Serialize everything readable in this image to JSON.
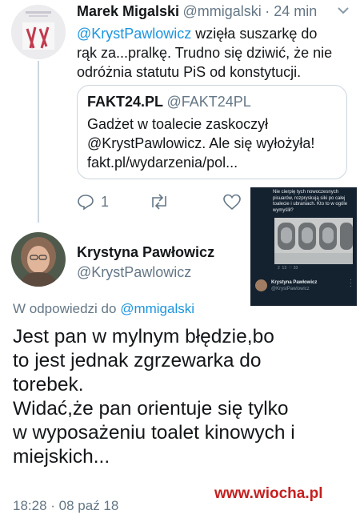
{
  "tweet1": {
    "author_name": "Marek Migalski",
    "author_handle": "@mmigalski",
    "time": "· 24 min",
    "text_mention": "@KrystPawlowicz",
    "text_line1_rest": " wzięła suszarkę do",
    "text_line2": "rąk za...pralkę. Trudno się dziwić, że nie",
    "text_line3": "odróżnia statutu PiS od konstytucji.",
    "quote": {
      "name": "FAKT24.PL",
      "handle": "@FAKT24PL",
      "line1": "Gadżet w toalecie zaskoczył",
      "line2": "@KrystPawlowicz. Ale się wyłożyła!",
      "line3": "fakt.pl/wydarzenia/pol..."
    },
    "reply_count": "1",
    "icons": [
      "reply-icon",
      "retweet-icon",
      "like-icon",
      "chevron-down-icon"
    ]
  },
  "thumbnail": {
    "caption_line1": "Nie cierpię tych nowoczesnych",
    "caption_line2": "pisuarów, rozpryskują siki po całej",
    "caption_line3": "toalecie i ubraniach. Kto to w ogóle",
    "caption_line4": "wymyślił?",
    "stats": "2  13  ♡ 33",
    "author_name": "Krystyna Pawłowicz",
    "author_handle": "@KrystPawlowicz"
  },
  "tweet2": {
    "author_name": "Krystyna Pawłowicz",
    "author_handle": "@KrystPawlowicz",
    "reply_prefix": "W odpowiedzi do",
    "reply_to": "@mmigalski",
    "text_line1": "Jest pan w mylnym błędzie,bo",
    "text_line2": "to jest jednak zgrzewarka do",
    "text_line3": "torebek.",
    "text_line4": "Widać,że pan orientuje się tylko",
    "text_line5": "w wyposażeniu toalet kinowych i",
    "text_line6": "miejskich...",
    "timestamp": "18:28 · 08 paź 18"
  },
  "watermark": "www.wiocha.pl",
  "colors": {
    "link": "#1b95e0",
    "secondary": "#657786",
    "border": "#ccd6dd",
    "watermark_red": "#c51f1f"
  }
}
